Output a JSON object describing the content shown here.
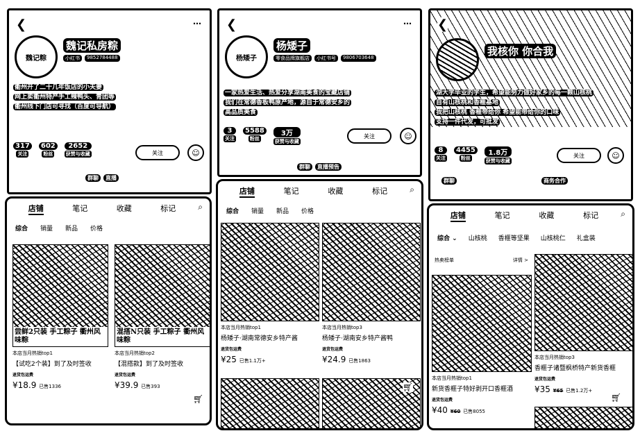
{
  "panels": [
    {
      "profile": {
        "name": "魏记私房粽",
        "avatar_text": "魏记粽",
        "badges": [
          "小红书",
          "9852784488"
        ],
        "bio": [
          "衢州开了二十几年饭店的小夫妻",
          "网上卖衢州特产手工辣鸭头、青团等",
          "衢州线下门店可寻找（百度可导航）"
        ],
        "stats": [
          {
            "n": "317",
            "l": "关注"
          },
          {
            "n": "602",
            "l": "粉丝"
          },
          {
            "n": "2652",
            "l": "获赞与收藏"
          }
        ],
        "follow": "关注",
        "tags": [
          "群聊",
          "直播"
        ]
      },
      "tabs": [
        "店铺",
        "笔记",
        "收藏",
        "标记"
      ],
      "filters": [
        "综合",
        "销量",
        "新品",
        "价格"
      ],
      "products": [
        {
          "overlay": "尝鲜2只装 手工粽子 衢州风味粽",
          "rank": "本店当月热销top1",
          "title": "【试吃2个装】到了及时签收",
          "ship": "退货包运费",
          "price": "¥18.9",
          "sold": "已售1336"
        },
        {
          "overlay": "混搭N只装 手工粽子 衢州风味粽",
          "rank": "本店当月热销top2",
          "title": "【混搭款】到了及时签收",
          "ship": "退货包运费",
          "price": "¥39.9",
          "sold": "已售393"
        }
      ]
    },
    {
      "profile": {
        "name": "杨矮子",
        "avatar_text": "杨矮子",
        "badges": [
          "零食品牌旗舰店",
          "小红书号",
          "9806703648"
        ],
        "bio": [
          "一家热爱生活、热爱分享湖南美食的宝藏店铺",
          "我们在常德香板鸭原产地，源自于常德安乡的",
          "高品质美食"
        ],
        "stats": [
          {
            "n": "3",
            "l": "关注"
          },
          {
            "n": "5588",
            "l": "粉丝"
          },
          {
            "n": "3万",
            "l": "获赞与收藏"
          }
        ],
        "follow": "关注",
        "tags": [
          "群聊",
          "直播预告"
        ]
      },
      "tabs": [
        "店铺",
        "笔记",
        "收藏",
        "标记"
      ],
      "filters": [
        "综合",
        "销量",
        "新品",
        "价格"
      ],
      "products": [
        {
          "rank": "本店当月热销top1",
          "title": "杨矮子·湖南常德安乡特产酱",
          "ship": "退货包运费",
          "price": "¥25",
          "sold": "已售1.1万+"
        },
        {
          "rank": "本店当月热销top3",
          "title": "杨矮子·湖南安乡特产酱鸭",
          "ship": "退货包运费",
          "price": "¥24.9",
          "sold": "已售1863"
        }
      ]
    },
    {
      "profile": {
        "name": "我核你 你合我",
        "bio": [
          "湖大学毕业的学生，希望能努力做好家乡的每一颗山核桃",
          "自有山核桃和香榧基地",
          "我把山核桃 香榧带给你 希望能带给你的口味",
          "支持一件代发，可批发"
        ],
        "stats": [
          {
            "n": "8",
            "l": "关注"
          },
          {
            "n": "4455",
            "l": "粉丝"
          },
          {
            "n": "1.8万",
            "l": "获赞与收藏"
          }
        ],
        "follow": "关注",
        "tags": [
          "群聊",
          "商务合作"
        ]
      },
      "tabs": [
        "店铺",
        "笔记",
        "收藏",
        "标记"
      ],
      "filters": [
        "综合 ⌄",
        "山核桃",
        "香榧等坚果",
        "山核桃仁",
        "礼盒装"
      ],
      "ranking": {
        "label": "热卖榜单",
        "more": "详情 >"
      },
      "products": [
        {
          "rank": "本店当月热销top1",
          "title": "新货香榧子特好剥开口香榧酒",
          "ship": "退货包运费",
          "price": "¥40",
          "orig": "¥60",
          "sold": "已售8055"
        },
        {
          "rank": "本店当月热销top3",
          "title": "香榧子诸暨枫桥特产新货香榧",
          "ship": "退货包运费",
          "price": "¥35",
          "orig": "¥65",
          "sold": "已售1.2万+"
        }
      ]
    }
  ]
}
